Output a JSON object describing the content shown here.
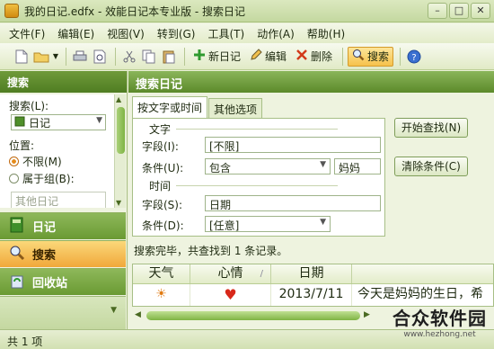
{
  "window": {
    "title": "我的日记.edfx - 效能日记本专业版 - 搜索日记",
    "buttons": [
      "–",
      "□",
      "✕"
    ]
  },
  "menu": [
    "文件(F)",
    "编辑(E)",
    "视图(V)",
    "转到(G)",
    "工具(T)",
    "动作(A)",
    "帮助(H)"
  ],
  "toolbar": {
    "new_diary": "新日记",
    "edit": "编辑",
    "delete": "删除",
    "search": "搜索"
  },
  "left": {
    "header": "搜索",
    "search_in_label": "搜索(L):",
    "search_in_value": "日记",
    "position_label": "位置:",
    "radio_unlimited": "不限(M)",
    "radio_group": "属于组(B):",
    "group_value": "其他日记",
    "nav": [
      "日记",
      "搜索",
      "回收站"
    ]
  },
  "right": {
    "header": "搜索日记",
    "tabs": [
      "按文字或时间",
      "其他选项"
    ],
    "text_group": "文字",
    "field_label_1": "字段(I):",
    "field_value_1": "[不限]",
    "cond_label_1": "条件(U):",
    "cond_value_1": "包含",
    "cond_text_1": "妈妈",
    "time_group": "时间",
    "field_label_2": "字段(S):",
    "field_value_2": "日期",
    "cond_label_2": "条件(D):",
    "cond_value_2": "[任意]",
    "btn_search": "开始查找(N)",
    "btn_clear": "清除条件(C)",
    "status": "搜索完毕，共查找到 1 条记录。"
  },
  "table": {
    "columns": [
      "天气",
      "心情",
      "日期",
      ""
    ],
    "rows": [
      {
        "weather": "☀",
        "mood": "♥",
        "date": "2013/7/11",
        "content": "今天是妈妈的生日，希"
      }
    ]
  },
  "statusbar": {
    "text": "共 1 项"
  },
  "watermark": {
    "main": "合众软件园",
    "sub": "www.hezhong.net"
  }
}
